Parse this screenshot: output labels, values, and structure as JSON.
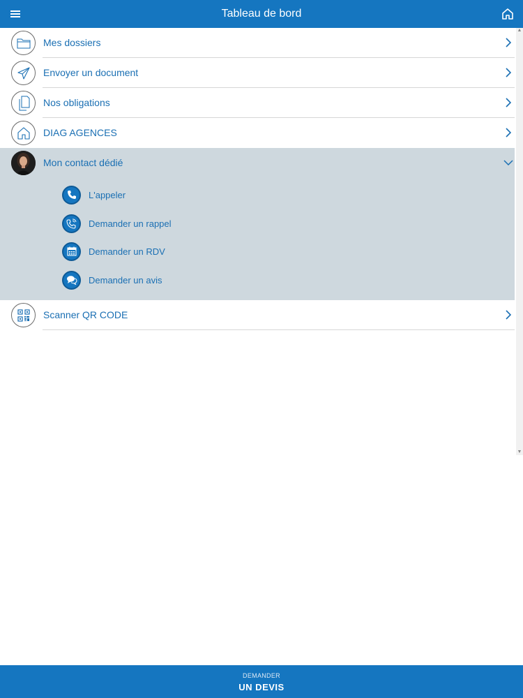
{
  "header": {
    "title": "Tableau de bord",
    "menu_icon": "hamburger-menu-icon",
    "home_icon": "home-icon"
  },
  "menu": {
    "items": [
      {
        "label": "Mes dossiers",
        "icon": "folder-icon"
      },
      {
        "label": "Envoyer un document",
        "icon": "send-paper-plane-icon"
      },
      {
        "label": "Nos obligations",
        "icon": "documents-icon"
      },
      {
        "label": "DIAG AGENCES",
        "icon": "house-icon"
      }
    ],
    "contact": {
      "label": "Mon contact dédié",
      "expanded": true,
      "actions": [
        {
          "label": "L'appeler",
          "icon": "phone-icon"
        },
        {
          "label": "Demander un rappel",
          "icon": "phone-callback-icon"
        },
        {
          "label": "Demander un RDV",
          "icon": "calendar-icon"
        },
        {
          "label": "Demander un avis",
          "icon": "chat-bubbles-icon"
        }
      ]
    },
    "after": [
      {
        "label": "Scanner QR CODE",
        "icon": "qr-code-icon"
      }
    ]
  },
  "footer": {
    "line1": "DEMANDER",
    "line2": "UN DEVIS"
  },
  "colors": {
    "primary": "#1576c0",
    "text_link": "#1a6fb3",
    "expanded_bg": "#ced8de",
    "divider": "#d6d6d6"
  }
}
